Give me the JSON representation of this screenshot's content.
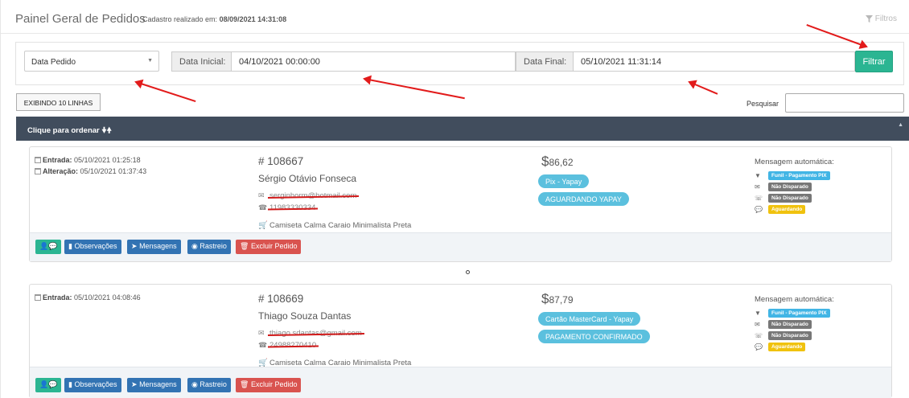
{
  "header": {
    "title": "Painel Geral de Pedidos",
    "subtitle_prefix": "Cadastro realizado em:",
    "subtitle_date": "08/09/2021 14:31:08",
    "filters_label": "Filtros"
  },
  "filter": {
    "date_type": "Data Pedido",
    "start_label": "Data Inicial:",
    "start_value": "04/10/2021 00:00:00",
    "end_label": "Data Final:",
    "end_value": "05/10/2021 11:31:14",
    "filter_button": "Filtrar"
  },
  "table": {
    "rows_button": "EXIBINDO 10 LINHAS",
    "search_label": "Pesquisar",
    "sort_label": "Clique para ordenar"
  },
  "orders": [
    {
      "entry_label": "Entrada:",
      "entry": "05/10/2021 01:25:18",
      "change_label": "Alteração:",
      "change": "05/10/2021 01:37:43",
      "number": "# 108667",
      "customer": "Sérgio Otávio Fonseca",
      "email": "serginhorm@hotmail.com",
      "phone": "11983330334",
      "product": "Camiseta Calma Caraio Minimalista Preta",
      "currency": "$",
      "price": "86,62",
      "payment": "Pix - Yapay",
      "status": "AGUARDANDO YAPAY",
      "auto_title": "Mensagem automática:",
      "funnel": "Funil - Pagamento PIX",
      "email_status": "Não Disparado",
      "sms_status": "Não Disparado",
      "chat_status": "Aguardando"
    },
    {
      "entry_label": "Entrada:",
      "entry": "05/10/2021 04:08:46",
      "number": "# 108669",
      "customer": "Thiago Souza Dantas",
      "email": "thiago.sdantas@gmail.com",
      "phone": "24988270410",
      "product": "Camiseta Calma Caraio Minimalista Preta",
      "currency": "$",
      "price": "87,79",
      "payment": "Cartão MasterCard - Yapay",
      "status": "PAGAMENTO CONFIRMADO",
      "auto_title": "Mensagem automática:",
      "funnel": "Funil - Pagamento PIX",
      "email_status": "Não Disparado",
      "sms_status": "Não Disparado",
      "chat_status": "Aguardando"
    }
  ],
  "actions": {
    "notes": "Observações",
    "messages": "Mensagens",
    "tracking": "Rastreio",
    "delete": "Excluir Pedido"
  },
  "colors": {
    "accent_green": "#2bb592",
    "header_bar": "#414d5d",
    "pill_blue": "#5bc0de",
    "button_blue": "#3273b3",
    "danger": "#d9534f",
    "annotation_arrow": "#e21b1b"
  }
}
